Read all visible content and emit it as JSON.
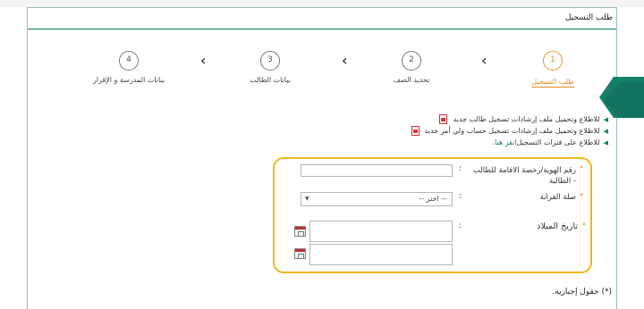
{
  "page": {
    "title": "طلب التسجيل"
  },
  "steps": [
    {
      "number": "1",
      "label": "طلب التسجيل",
      "active": true
    },
    {
      "number": "2",
      "label": "تحديد الصف",
      "active": false
    },
    {
      "number": "3",
      "label": "بيانات الطالب",
      "active": false
    },
    {
      "number": "4",
      "label": "بيانات المدرسة و الإقرار",
      "active": false
    }
  ],
  "links": {
    "student_guide": "للاطلاع وتحميل ملف إرشادات تسجيل طالب جديد",
    "parent_guide": "للاطلاع وتحميل ملف إرشادات تسجيل حساب ولي أمر جديد",
    "periods_prefix": "للاطلاع على فترات التسجيل",
    "periods_link": "انقر هنا."
  },
  "form": {
    "required_mark": "*",
    "colon": ":",
    "id_label": "رقم الهوية/رخصة الاقامة للطالب - الطالبة",
    "id_value": "",
    "relation_label": "صلة القرابة",
    "relation_selected": "-- اختر --",
    "birthdate_label": "تاريخ الميلاد",
    "birthdate_hijri": "",
    "birthdate_gregorian": ""
  },
  "footer": {
    "required_note": "(*) حقول إجبارية."
  },
  "colors": {
    "accent": "#157f6b",
    "active_step": "#e08a1c",
    "highlight_box": "#f1b51c"
  }
}
